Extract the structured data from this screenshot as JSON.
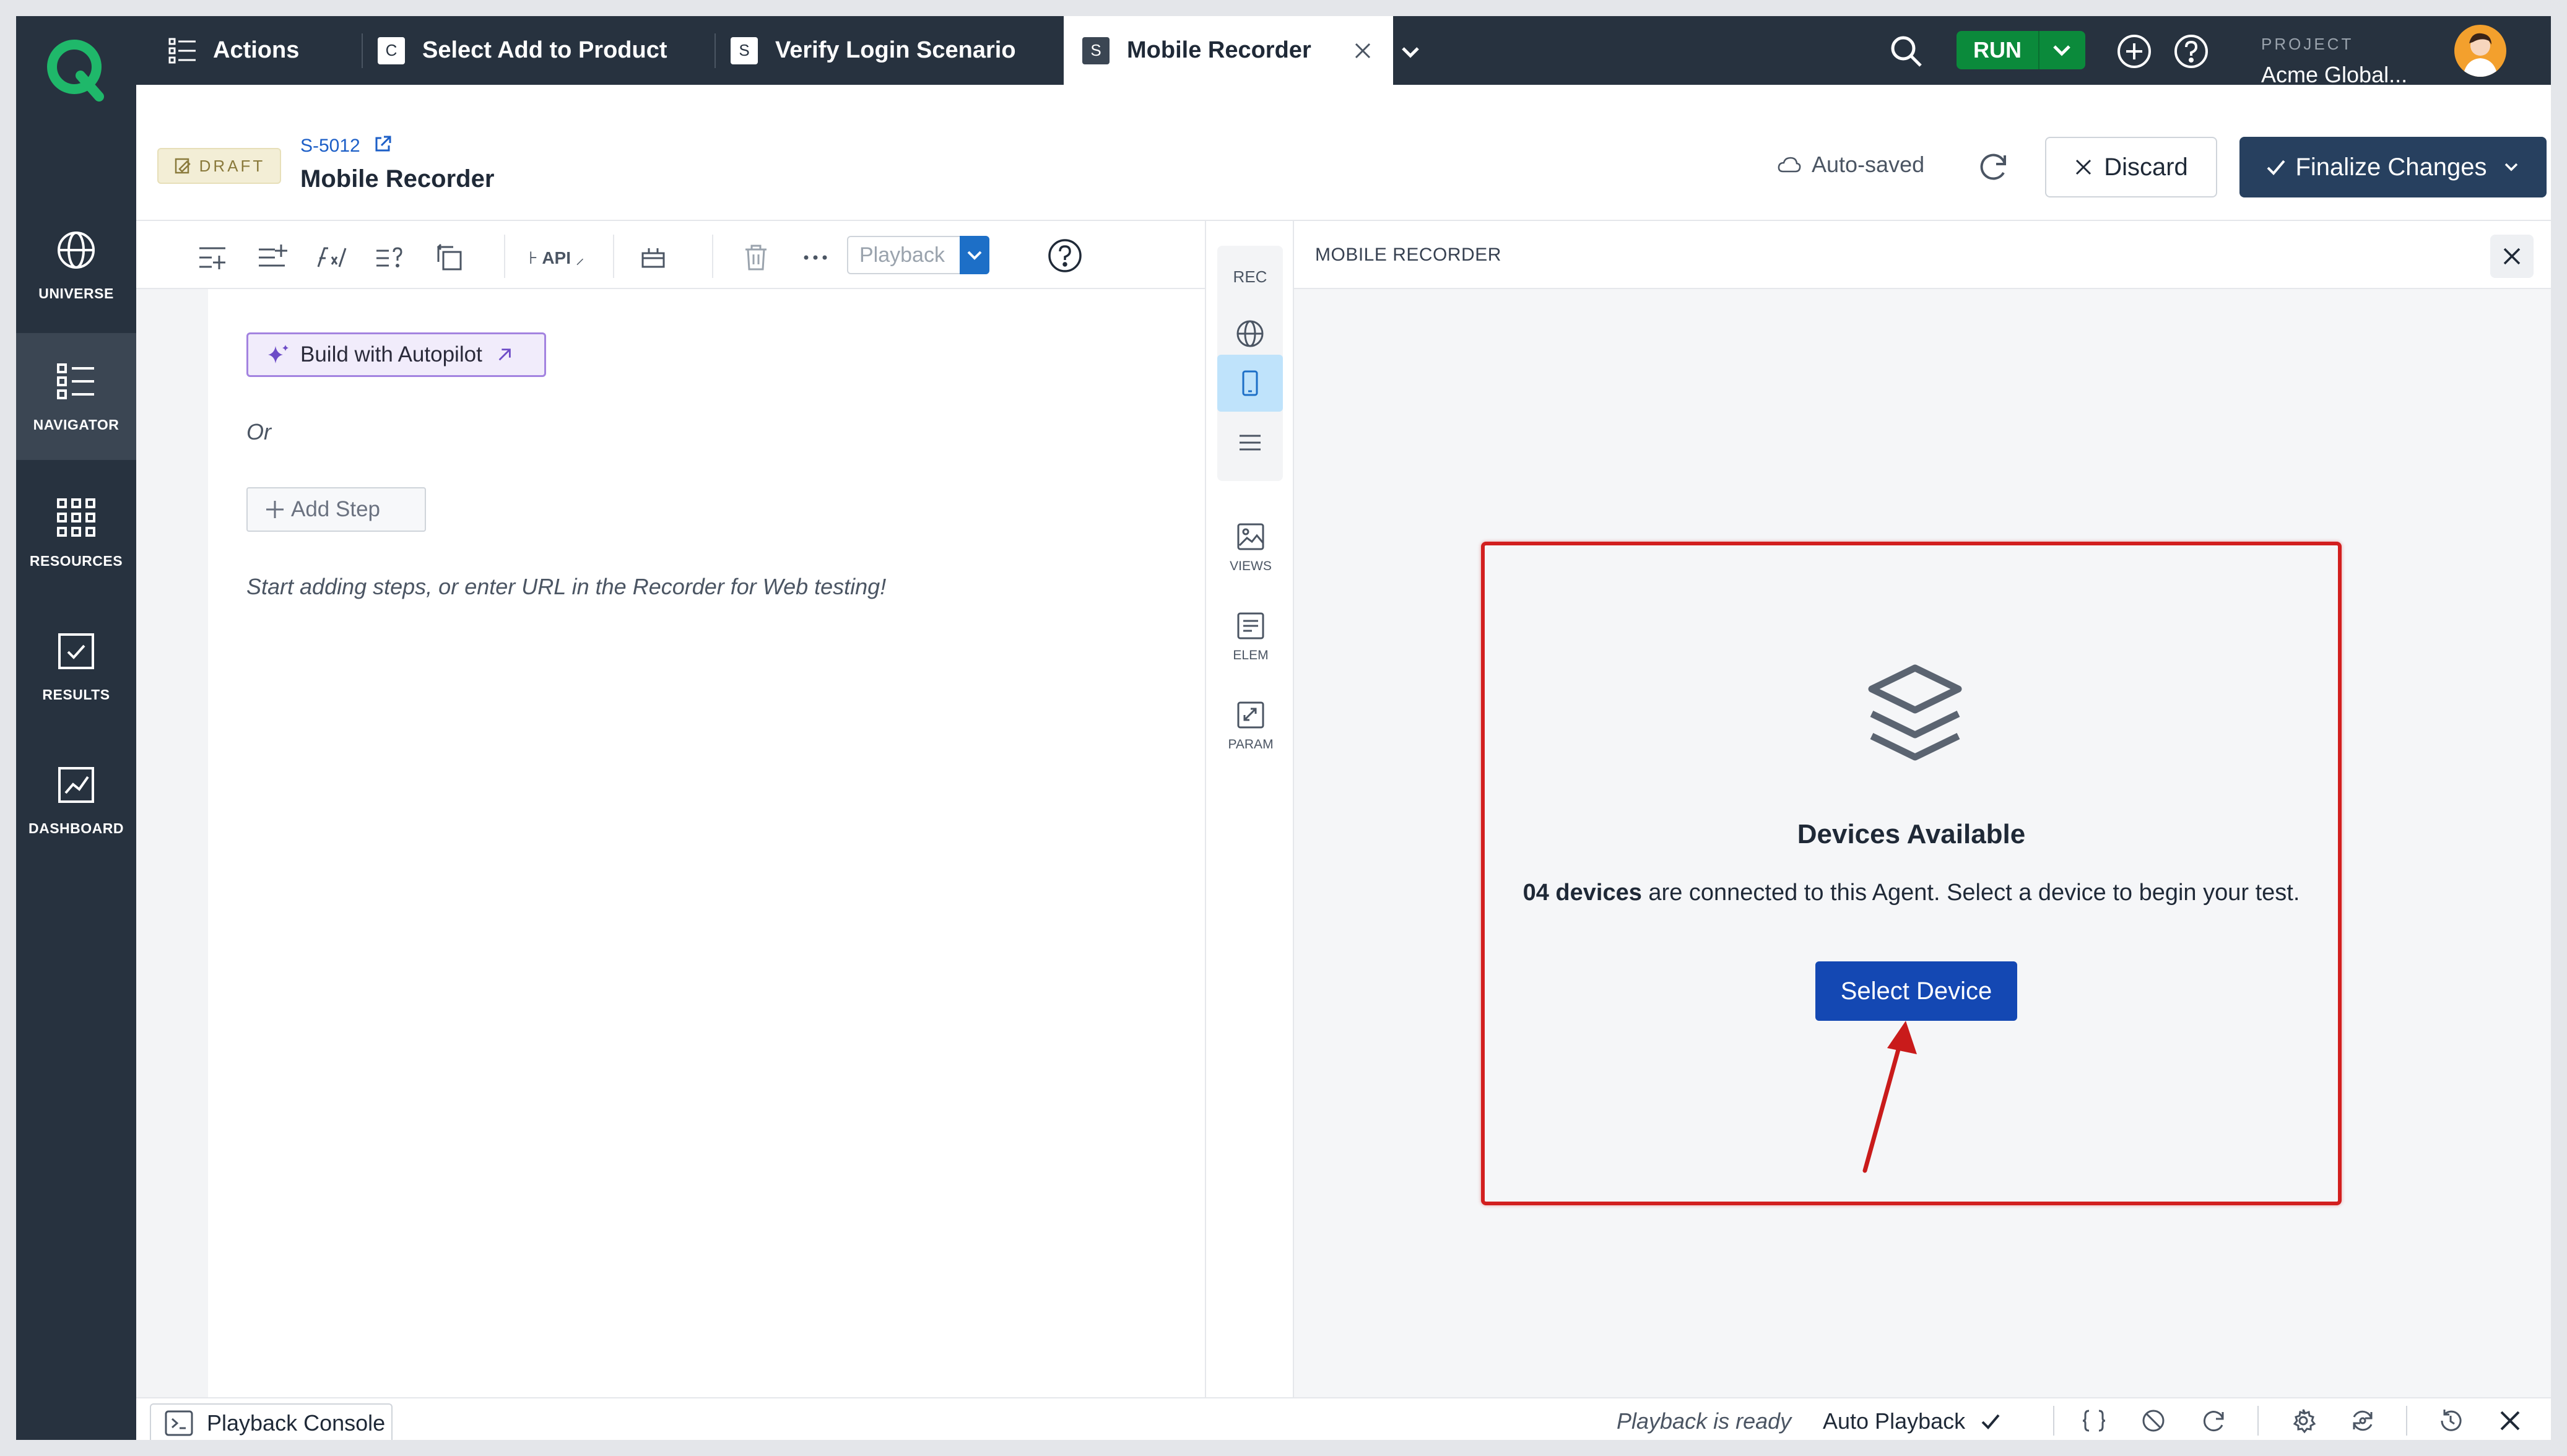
{
  "nav": {
    "items": [
      {
        "label": "UNIVERSE",
        "icon": "globe-icon"
      },
      {
        "label": "NAVIGATOR",
        "icon": "list-icon"
      },
      {
        "label": "RESOURCES",
        "icon": "grid-icon"
      },
      {
        "label": "RESULTS",
        "icon": "checkbox-icon"
      },
      {
        "label": "DASHBOARD",
        "icon": "chart-icon"
      }
    ],
    "active": "NAVIGATOR"
  },
  "tabs": [
    {
      "label": "Actions",
      "badge": ""
    },
    {
      "label": "Select Add to Product",
      "badge": "C"
    },
    {
      "label": "Verify Login Scenario",
      "badge": "S"
    },
    {
      "label": "Mobile Recorder",
      "badge": "S"
    }
  ],
  "topbar": {
    "run_label": "RUN",
    "project_label": "PROJECT",
    "project_name": "Acme Global..."
  },
  "header": {
    "status_badge": "DRAFT",
    "script_id": "S-5012",
    "title": "Mobile Recorder",
    "autosave_text": "Auto-saved",
    "discard_label": "Discard",
    "finalize_label": "Finalize Changes"
  },
  "editor": {
    "api_label": "API",
    "playback_placeholder": "Playback",
    "autopilot_label": "Build with Autopilot",
    "or_text": "Or",
    "add_step_label": "Add Step",
    "hint": "Start adding steps, or enter URL in the Recorder for Web testing!"
  },
  "rail": {
    "rec_label": "REC",
    "views_label": "VIEWS",
    "elem_label": "ELEM",
    "param_label": "PARAM"
  },
  "recorder": {
    "title": "MOBILE RECORDER",
    "card_title": "Devices Available",
    "device_count": "04 devices",
    "card_text_rest": " are connected to this Agent. Select a device to begin your test.",
    "select_button": "Select Device"
  },
  "statusbar": {
    "console_label": "Playback Console",
    "playback_status": "Playback is ready",
    "auto_playback": "Auto Playback"
  },
  "colors": {
    "nav_bg": "#27323f",
    "run_green": "#0b8a3b",
    "primary_blue": "#1448b3",
    "highlight_red": "#d21f1f",
    "autopilot_purple": "#a383e0"
  }
}
